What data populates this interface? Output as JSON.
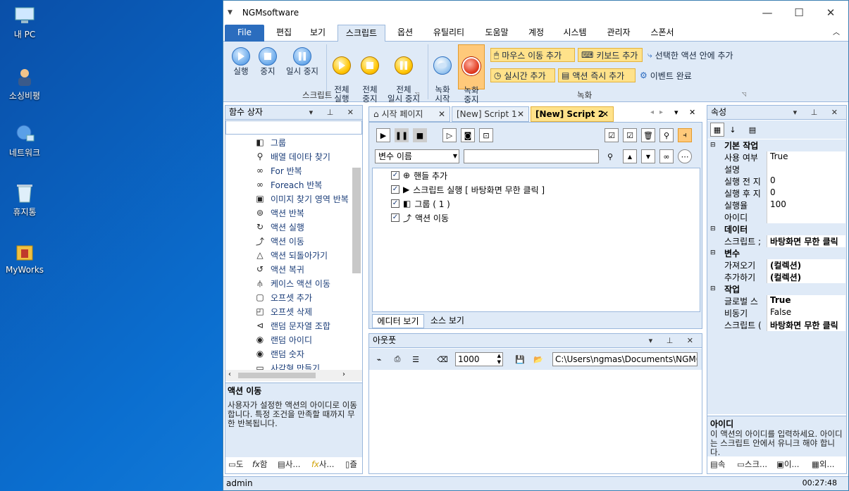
{
  "desktop": {
    "icons": [
      {
        "label": "내 PC"
      },
      {
        "label": "소싱비평"
      },
      {
        "label": "네트워크"
      },
      {
        "label": "휴지통"
      },
      {
        "label": "MyWorks"
      }
    ]
  },
  "window": {
    "title": "NGMsoftware"
  },
  "menu": {
    "file": "File",
    "items": [
      "편집",
      "보기",
      "스크립트",
      "옵션",
      "유틸리티",
      "도움말",
      "계정",
      "시스템",
      "관리자",
      "스폰서"
    ]
  },
  "ribbon": {
    "script_group": {
      "label": "스크립트",
      "buttons": [
        {
          "label": "실행"
        },
        {
          "label": "중지"
        },
        {
          "label": "일시 중지"
        },
        {
          "label": "전체\n실행"
        },
        {
          "label": "전체\n중지"
        },
        {
          "label": "전체\n일시 중지"
        }
      ]
    },
    "record_group": {
      "label": "녹화",
      "start": "녹화\n시작",
      "stop": "녹화\n중지",
      "mouse_move": "마우스 이동 추가",
      "keyboard": "키보드 추가",
      "add_in_selected": "선택한 액션 안에 추가",
      "realtime": "실시간 추가",
      "action_now": "액션 즉시 추가",
      "event_done": "이벤트 완료"
    }
  },
  "function_box": {
    "title": "함수 상자",
    "search_value": "",
    "items": [
      "그룹",
      "배열 데이타 찾기",
      "For 반복",
      "Foreach 반복",
      "이미지 찾기 영역 반복",
      "액션 반복",
      "액션 실행",
      "액션 이동",
      "액션 되돌아가기",
      "액션 복귀",
      "케이스 액션 이동",
      "오프셋 추가",
      "오프셋 삭제",
      "랜덤 문자열 조합",
      "랜덤 아이디",
      "랜덤 숫자",
      "사각형 만들기"
    ],
    "desc_title": "액션 이동",
    "desc_text": "사용자가 설정한 액션의 아이디로 이동합니다. 특정 조건을 만족할 때까지 무한 반복됩니다.",
    "bottom_tabs": [
      "도",
      "함",
      "사...",
      "사...",
      "즐"
    ]
  },
  "doc_tabs": [
    "시작 페이지",
    "[New] Script 1",
    "[New] Script 2"
  ],
  "editor": {
    "var_select": "변수 이름",
    "var_input": "",
    "tree": [
      {
        "label": "핸들 추가"
      },
      {
        "label": "스크립트 실행 [ 바탕화면 무한 클릭 ]"
      },
      {
        "label": "그룹 ( 1 )"
      },
      {
        "label": "액션 이동"
      }
    ],
    "view_tabs": [
      "에디터 보기",
      "소스 보기"
    ]
  },
  "output": {
    "title": "아웃풋",
    "count": "1000",
    "path": "C:\\Users\\ngmas\\Documents\\NGM6\\"
  },
  "properties": {
    "title": "속성",
    "categories": [
      {
        "name": "기본 작업",
        "rows": [
          {
            "k": "사용 여부",
            "v": "True"
          },
          {
            "k": "설명",
            "v": ""
          },
          {
            "k": "실행 전 지",
            "v": "0"
          },
          {
            "k": "실행 후 지",
            "v": "0"
          },
          {
            "k": "실행율",
            "v": "100"
          },
          {
            "k": "아이디",
            "v": ""
          }
        ]
      },
      {
        "name": "데이터",
        "rows": [
          {
            "k": "스크립트 ;",
            "v": "바탕화면 무한 클릭"
          }
        ]
      },
      {
        "name": "변수",
        "rows": [
          {
            "k": "가져오기",
            "v": "(컬렉션)"
          },
          {
            "k": "추가하기",
            "v": "(컬렉션)"
          }
        ]
      },
      {
        "name": "작업",
        "rows": [
          {
            "k": "글로벌 스",
            "v": "True"
          },
          {
            "k": "비동기",
            "v": "False"
          },
          {
            "k": "스크립트 (",
            "v": "바탕화면 무한 클릭"
          }
        ]
      }
    ],
    "desc_title": "아이디",
    "desc_text": "이 액션의 아이디를 입력하세요. 아이디는 스크립트 안에서 유니크 해야 합니다.",
    "bottom_tabs": [
      "속",
      "스크...",
      "이...",
      "외..."
    ]
  },
  "status": {
    "user": "admin",
    "time": "00:27:48"
  }
}
